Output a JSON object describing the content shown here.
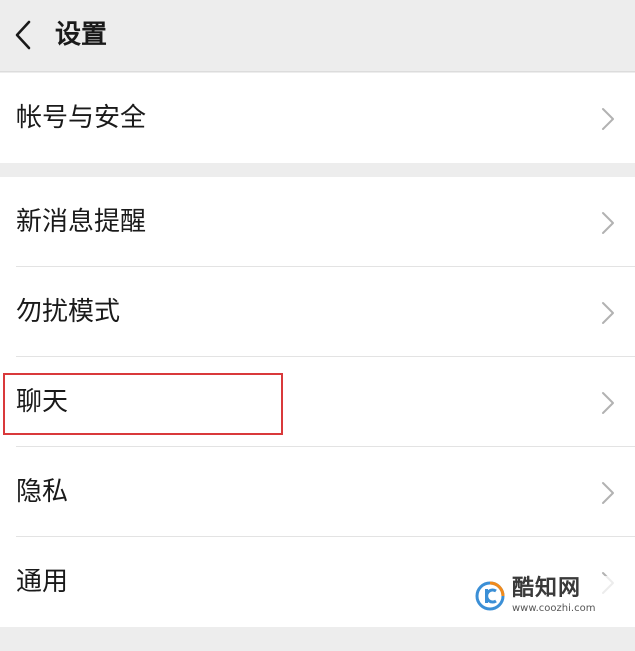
{
  "header": {
    "title": "设置",
    "back_icon": "chevron-left-icon"
  },
  "groups": [
    {
      "items": [
        {
          "label": "帐号与安全"
        }
      ]
    },
    {
      "items": [
        {
          "label": "新消息提醒"
        },
        {
          "label": "勿扰模式"
        },
        {
          "label": "聊天",
          "highlighted": true
        },
        {
          "label": "隐私"
        },
        {
          "label": "通用"
        }
      ]
    }
  ],
  "watermark": {
    "title": "酷知网",
    "url": "www.coozhi.com"
  },
  "colors": {
    "background": "#ededed",
    "highlight": "#d9393b",
    "chevron": "#b2b2b2"
  }
}
